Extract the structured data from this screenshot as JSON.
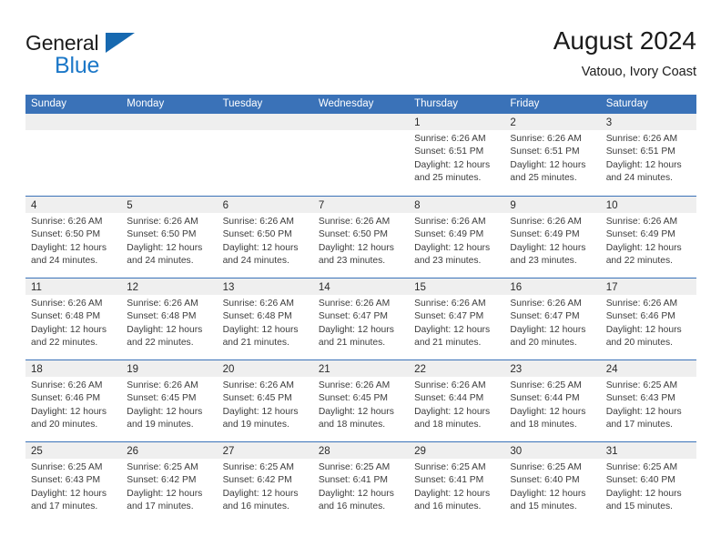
{
  "logo": {
    "word_top": "General",
    "word_bottom": "Blue",
    "triangle_color": "#1769b0",
    "blue_color": "#1c78c8"
  },
  "header": {
    "title": "August 2024",
    "subtitle": "Vatouo, Ivory Coast"
  },
  "theme": {
    "header_blue": "#3a72b8",
    "daynum_band": "#efefef",
    "text": "#3c3c3c"
  },
  "weekdays": [
    "Sunday",
    "Monday",
    "Tuesday",
    "Wednesday",
    "Thursday",
    "Friday",
    "Saturday"
  ],
  "weeks": [
    [
      {
        "day": "",
        "empty": true,
        "l1": "",
        "l2": "",
        "l3": "",
        "l4": ""
      },
      {
        "day": "",
        "empty": true,
        "l1": "",
        "l2": "",
        "l3": "",
        "l4": ""
      },
      {
        "day": "",
        "empty": true,
        "l1": "",
        "l2": "",
        "l3": "",
        "l4": ""
      },
      {
        "day": "",
        "empty": true,
        "l1": "",
        "l2": "",
        "l3": "",
        "l4": ""
      },
      {
        "day": "1",
        "empty": false,
        "l1": "Sunrise: 6:26 AM",
        "l2": "Sunset: 6:51 PM",
        "l3": "Daylight: 12 hours",
        "l4": "and 25 minutes."
      },
      {
        "day": "2",
        "empty": false,
        "l1": "Sunrise: 6:26 AM",
        "l2": "Sunset: 6:51 PM",
        "l3": "Daylight: 12 hours",
        "l4": "and 25 minutes."
      },
      {
        "day": "3",
        "empty": false,
        "l1": "Sunrise: 6:26 AM",
        "l2": "Sunset: 6:51 PM",
        "l3": "Daylight: 12 hours",
        "l4": "and 24 minutes."
      }
    ],
    [
      {
        "day": "4",
        "empty": false,
        "l1": "Sunrise: 6:26 AM",
        "l2": "Sunset: 6:50 PM",
        "l3": "Daylight: 12 hours",
        "l4": "and 24 minutes."
      },
      {
        "day": "5",
        "empty": false,
        "l1": "Sunrise: 6:26 AM",
        "l2": "Sunset: 6:50 PM",
        "l3": "Daylight: 12 hours",
        "l4": "and 24 minutes."
      },
      {
        "day": "6",
        "empty": false,
        "l1": "Sunrise: 6:26 AM",
        "l2": "Sunset: 6:50 PM",
        "l3": "Daylight: 12 hours",
        "l4": "and 24 minutes."
      },
      {
        "day": "7",
        "empty": false,
        "l1": "Sunrise: 6:26 AM",
        "l2": "Sunset: 6:50 PM",
        "l3": "Daylight: 12 hours",
        "l4": "and 23 minutes."
      },
      {
        "day": "8",
        "empty": false,
        "l1": "Sunrise: 6:26 AM",
        "l2": "Sunset: 6:49 PM",
        "l3": "Daylight: 12 hours",
        "l4": "and 23 minutes."
      },
      {
        "day": "9",
        "empty": false,
        "l1": "Sunrise: 6:26 AM",
        "l2": "Sunset: 6:49 PM",
        "l3": "Daylight: 12 hours",
        "l4": "and 23 minutes."
      },
      {
        "day": "10",
        "empty": false,
        "l1": "Sunrise: 6:26 AM",
        "l2": "Sunset: 6:49 PM",
        "l3": "Daylight: 12 hours",
        "l4": "and 22 minutes."
      }
    ],
    [
      {
        "day": "11",
        "empty": false,
        "l1": "Sunrise: 6:26 AM",
        "l2": "Sunset: 6:48 PM",
        "l3": "Daylight: 12 hours",
        "l4": "and 22 minutes."
      },
      {
        "day": "12",
        "empty": false,
        "l1": "Sunrise: 6:26 AM",
        "l2": "Sunset: 6:48 PM",
        "l3": "Daylight: 12 hours",
        "l4": "and 22 minutes."
      },
      {
        "day": "13",
        "empty": false,
        "l1": "Sunrise: 6:26 AM",
        "l2": "Sunset: 6:48 PM",
        "l3": "Daylight: 12 hours",
        "l4": "and 21 minutes."
      },
      {
        "day": "14",
        "empty": false,
        "l1": "Sunrise: 6:26 AM",
        "l2": "Sunset: 6:47 PM",
        "l3": "Daylight: 12 hours",
        "l4": "and 21 minutes."
      },
      {
        "day": "15",
        "empty": false,
        "l1": "Sunrise: 6:26 AM",
        "l2": "Sunset: 6:47 PM",
        "l3": "Daylight: 12 hours",
        "l4": "and 21 minutes."
      },
      {
        "day": "16",
        "empty": false,
        "l1": "Sunrise: 6:26 AM",
        "l2": "Sunset: 6:47 PM",
        "l3": "Daylight: 12 hours",
        "l4": "and 20 minutes."
      },
      {
        "day": "17",
        "empty": false,
        "l1": "Sunrise: 6:26 AM",
        "l2": "Sunset: 6:46 PM",
        "l3": "Daylight: 12 hours",
        "l4": "and 20 minutes."
      }
    ],
    [
      {
        "day": "18",
        "empty": false,
        "l1": "Sunrise: 6:26 AM",
        "l2": "Sunset: 6:46 PM",
        "l3": "Daylight: 12 hours",
        "l4": "and 20 minutes."
      },
      {
        "day": "19",
        "empty": false,
        "l1": "Sunrise: 6:26 AM",
        "l2": "Sunset: 6:45 PM",
        "l3": "Daylight: 12 hours",
        "l4": "and 19 minutes."
      },
      {
        "day": "20",
        "empty": false,
        "l1": "Sunrise: 6:26 AM",
        "l2": "Sunset: 6:45 PM",
        "l3": "Daylight: 12 hours",
        "l4": "and 19 minutes."
      },
      {
        "day": "21",
        "empty": false,
        "l1": "Sunrise: 6:26 AM",
        "l2": "Sunset: 6:45 PM",
        "l3": "Daylight: 12 hours",
        "l4": "and 18 minutes."
      },
      {
        "day": "22",
        "empty": false,
        "l1": "Sunrise: 6:26 AM",
        "l2": "Sunset: 6:44 PM",
        "l3": "Daylight: 12 hours",
        "l4": "and 18 minutes."
      },
      {
        "day": "23",
        "empty": false,
        "l1": "Sunrise: 6:25 AM",
        "l2": "Sunset: 6:44 PM",
        "l3": "Daylight: 12 hours",
        "l4": "and 18 minutes."
      },
      {
        "day": "24",
        "empty": false,
        "l1": "Sunrise: 6:25 AM",
        "l2": "Sunset: 6:43 PM",
        "l3": "Daylight: 12 hours",
        "l4": "and 17 minutes."
      }
    ],
    [
      {
        "day": "25",
        "empty": false,
        "l1": "Sunrise: 6:25 AM",
        "l2": "Sunset: 6:43 PM",
        "l3": "Daylight: 12 hours",
        "l4": "and 17 minutes."
      },
      {
        "day": "26",
        "empty": false,
        "l1": "Sunrise: 6:25 AM",
        "l2": "Sunset: 6:42 PM",
        "l3": "Daylight: 12 hours",
        "l4": "and 17 minutes."
      },
      {
        "day": "27",
        "empty": false,
        "l1": "Sunrise: 6:25 AM",
        "l2": "Sunset: 6:42 PM",
        "l3": "Daylight: 12 hours",
        "l4": "and 16 minutes."
      },
      {
        "day": "28",
        "empty": false,
        "l1": "Sunrise: 6:25 AM",
        "l2": "Sunset: 6:41 PM",
        "l3": "Daylight: 12 hours",
        "l4": "and 16 minutes."
      },
      {
        "day": "29",
        "empty": false,
        "l1": "Sunrise: 6:25 AM",
        "l2": "Sunset: 6:41 PM",
        "l3": "Daylight: 12 hours",
        "l4": "and 16 minutes."
      },
      {
        "day": "30",
        "empty": false,
        "l1": "Sunrise: 6:25 AM",
        "l2": "Sunset: 6:40 PM",
        "l3": "Daylight: 12 hours",
        "l4": "and 15 minutes."
      },
      {
        "day": "31",
        "empty": false,
        "l1": "Sunrise: 6:25 AM",
        "l2": "Sunset: 6:40 PM",
        "l3": "Daylight: 12 hours",
        "l4": "and 15 minutes."
      }
    ]
  ]
}
